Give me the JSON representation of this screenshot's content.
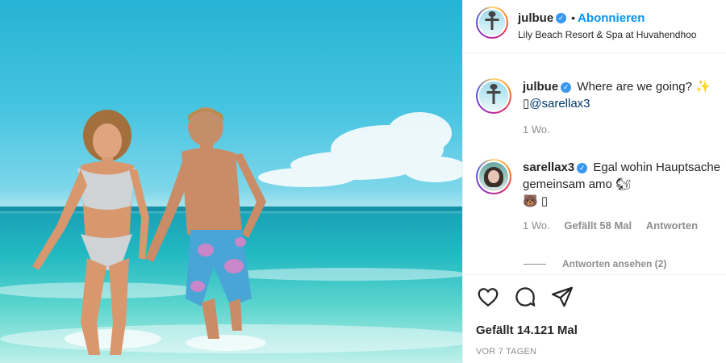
{
  "post": {
    "author": "julbue",
    "follow_label": "Abonnieren",
    "separator": "•",
    "location": "Lily Beach Resort & Spa at Huvahendhoo",
    "verified_glyph": "✓"
  },
  "comments": [
    {
      "username": "julbue",
      "text": "Where are we going? ✨",
      "mention": "@sarellax3",
      "mention_prefix": "▯",
      "time": "1 Wo."
    },
    {
      "username": "sarellax3",
      "text": "Egal wohin Hauptsache gemeinsam amo 🐿",
      "extra": "🐻 ▯",
      "time": "1 Wo.",
      "likes": "Gefällt 58 Mal",
      "reply_label": "Antworten"
    }
  ],
  "view_replies": "Antworten ansehen (2)",
  "likes_total": "Gefällt 14.121 Mal",
  "timestamp": "VOR 7 TAGEN",
  "icons": [
    "heart-icon",
    "comment-icon",
    "share-icon"
  ],
  "colors": {
    "accent": "#0095f6",
    "verified": "#3897f0",
    "text": "#262626",
    "muted": "#8e8e8e"
  }
}
